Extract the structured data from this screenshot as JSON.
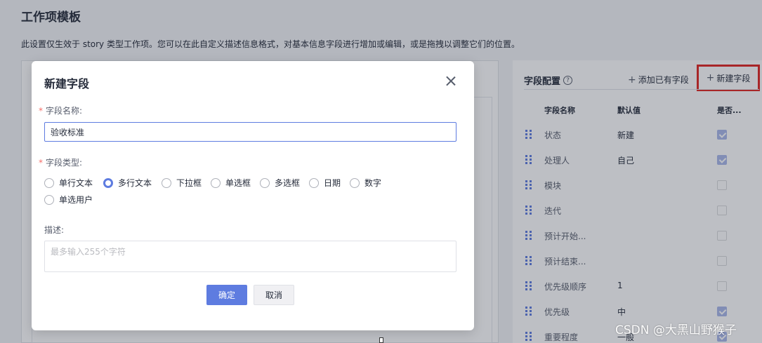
{
  "page": {
    "title": "工作项模板",
    "description": "此设置仅生效于 story 类型工作项。您可以在此自定义描述信息格式，对基本信息字段进行增加或编辑，或是拖拽以调整它们的位置。"
  },
  "field_config": {
    "title": "字段配置",
    "add_existing_label": "添加已有字段",
    "new_field_label": "新建字段",
    "columns": {
      "name": "字段名称",
      "default": "默认值",
      "required": "是否..."
    },
    "rows": [
      {
        "name": "状态",
        "default": "新建",
        "checked": true
      },
      {
        "name": "处理人",
        "default": "自己",
        "checked": true
      },
      {
        "name": "模块",
        "default": "",
        "checked": false
      },
      {
        "name": "迭代",
        "default": "",
        "checked": false
      },
      {
        "name": "预计开始...",
        "default": "",
        "checked": false
      },
      {
        "name": "预计结束...",
        "default": "",
        "checked": false
      },
      {
        "name": "优先级顺序",
        "default": "1",
        "checked": false
      },
      {
        "name": "优先级",
        "default": "中",
        "checked": true
      },
      {
        "name": "重要程度",
        "default": "一般",
        "checked": true
      }
    ]
  },
  "dialog": {
    "title": "新建字段",
    "name_label": "字段名称:",
    "name_value": "验收标准",
    "type_label": "字段类型:",
    "type_options": [
      "单行文本",
      "多行文本",
      "下拉框",
      "单选框",
      "多选框",
      "日期",
      "数字",
      "单选用户"
    ],
    "type_selected": "多行文本",
    "desc_label": "描述:",
    "desc_placeholder": "最多输入255个字符",
    "ok_label": "确定",
    "cancel_label": "取消"
  },
  "watermark": "CSDN @大黑山野猴子"
}
